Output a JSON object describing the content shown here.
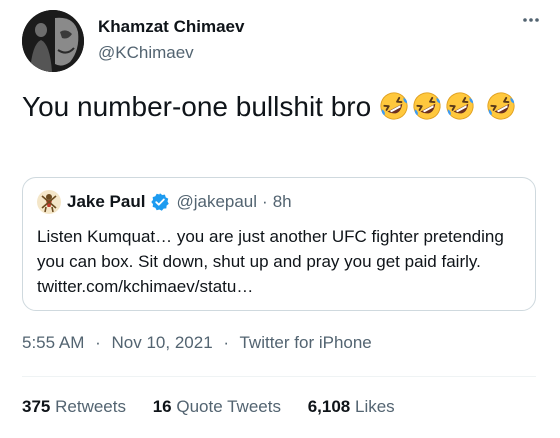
{
  "author": {
    "display_name": "Khamzat Chimaev",
    "handle": "@KChimaev"
  },
  "tweet": {
    "text": "You number-one bullshit bro",
    "emoji_icon": "rolling-on-floor-laughing-icon",
    "emoji_count": 4
  },
  "quoted_tweet": {
    "author_name": "Jake Paul",
    "author_handle": "@jakepaul",
    "separator": "·",
    "time": "8h",
    "text": "Listen Kumquat… you are just another UFC fighter pretending you can box. Sit down, shut up and pray you get paid fairly. twitter.com/kchimaev/statu…"
  },
  "meta": {
    "time": "5:55 AM",
    "separator": "·",
    "date": "Nov 10, 2021",
    "source": "Twitter for iPhone"
  },
  "stats": {
    "retweets_count": "375",
    "retweets_label": "Retweets",
    "quote_tweets_count": "16",
    "quote_tweets_label": "Quote Tweets",
    "likes_count": "6,108",
    "likes_label": "Likes"
  },
  "colors": {
    "text_primary": "#0f1419",
    "text_secondary": "#536471",
    "border": "#cfd9de",
    "verified": "#1d9bf0",
    "emoji_face": "#ffc83d",
    "emoji_tears": "#3b9bf5"
  }
}
